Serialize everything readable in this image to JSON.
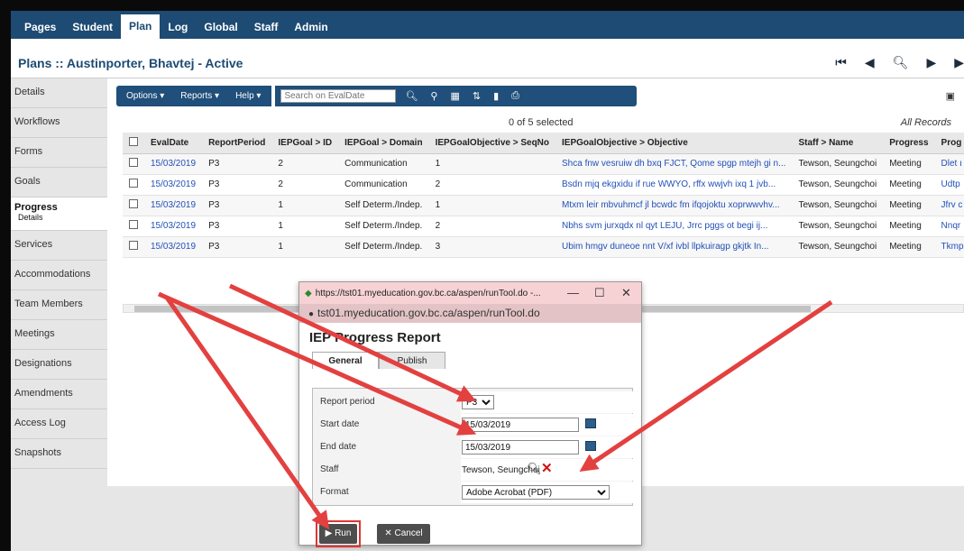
{
  "topnav": {
    "tabs": [
      "Pages",
      "Student",
      "Plan",
      "Log",
      "Global",
      "Staff",
      "Admin"
    ],
    "active": "Plan"
  },
  "page": {
    "title": "Plans :: Austinporter, Bhavtej - Active"
  },
  "navbtns": {
    "first": "⏮",
    "prev": "◀",
    "search": "🔍",
    "next": "▶",
    "last": "▶"
  },
  "sidebar": {
    "items": [
      {
        "label": "Details"
      },
      {
        "label": "Workflows"
      },
      {
        "label": "Forms"
      },
      {
        "label": "Goals"
      },
      {
        "label": "Progress",
        "sub": "Details"
      },
      {
        "label": "Services"
      },
      {
        "label": "Accommodations"
      },
      {
        "label": "Team Members"
      },
      {
        "label": "Meetings"
      },
      {
        "label": "Designations"
      },
      {
        "label": "Amendments"
      },
      {
        "label": "Access Log"
      },
      {
        "label": "Snapshots"
      }
    ]
  },
  "toolbar": {
    "options": "Options ▾",
    "reports": "Reports ▾",
    "help": "Help ▾",
    "search_placeholder": "Search on EvalDate"
  },
  "list": {
    "selected_info": "0 of 5 selected",
    "all_records": "All Records",
    "columns": [
      "EvalDate",
      "ReportPeriod",
      "IEPGoal > ID",
      "IEPGoal > Domain",
      "IEPGoalObjective > SeqNo",
      "IEPGoalObjective > Objective",
      "Staff > Name",
      "Progress",
      "Prog"
    ],
    "rows": [
      [
        "15/03/2019",
        "P3",
        "2",
        "Communication",
        "1",
        "Shca fnw vesruiw dh bxq FJCT, Qome spgp mtejh gi n...",
        "Tewson, Seungchoi",
        "Meeting",
        "Dlet ı"
      ],
      [
        "15/03/2019",
        "P3",
        "2",
        "Communication",
        "2",
        "Bsdn mjq ekgxidu if rue WWYO, rffx wwjvh ixq 1 jvb...",
        "Tewson, Seungchoi",
        "Meeting",
        "Udtp"
      ],
      [
        "15/03/2019",
        "P3",
        "1",
        "Self Determ./Indep.",
        "1",
        "Mtxm leir mbvuhmcf jl bcwdc fm ifqojoktu xoprwwvhv...",
        "Tewson, Seungchoi",
        "Meeting",
        "Jfrv c"
      ],
      [
        "15/03/2019",
        "P3",
        "1",
        "Self Determ./Indep.",
        "2",
        "Nbhs svm jurxqdx nl qyt LEJU, Jrrc pggs ot begi ij...",
        "Tewson, Seungchoi",
        "Meeting",
        "Nnqr"
      ],
      [
        "15/03/2019",
        "P3",
        "1",
        "Self Determ./Indep.",
        "3",
        "Ubim hmgv duneoe nnt V/xf ivbl llpkuiragp gkjtk In...",
        "Tewson, Seungchoi",
        "Meeting",
        "Tkmp"
      ]
    ]
  },
  "dialog": {
    "window_title": "https://tst01.myeducation.gov.bc.ca/aspen/runTool.do -...",
    "url": "tst01.myeducation.gov.bc.ca/aspen/runTool.do",
    "heading": "IEP Progress Report",
    "tabs": [
      "General",
      "Publish"
    ],
    "fields": {
      "report_period_label": "Report period",
      "report_period_value": "P3",
      "start_label": "Start date",
      "start_value": "15/03/2019",
      "end_label": "End date",
      "end_value": "15/03/2019",
      "staff_label": "Staff",
      "staff_value": "Tewson, Seungchoi",
      "format_label": "Format",
      "format_value": "Adobe Acrobat (PDF)"
    },
    "run": "Run",
    "cancel": "Cancel"
  },
  "colors": {
    "nav": "#1d4b73",
    "arrow": "#e34040",
    "link": "#2250b8"
  }
}
